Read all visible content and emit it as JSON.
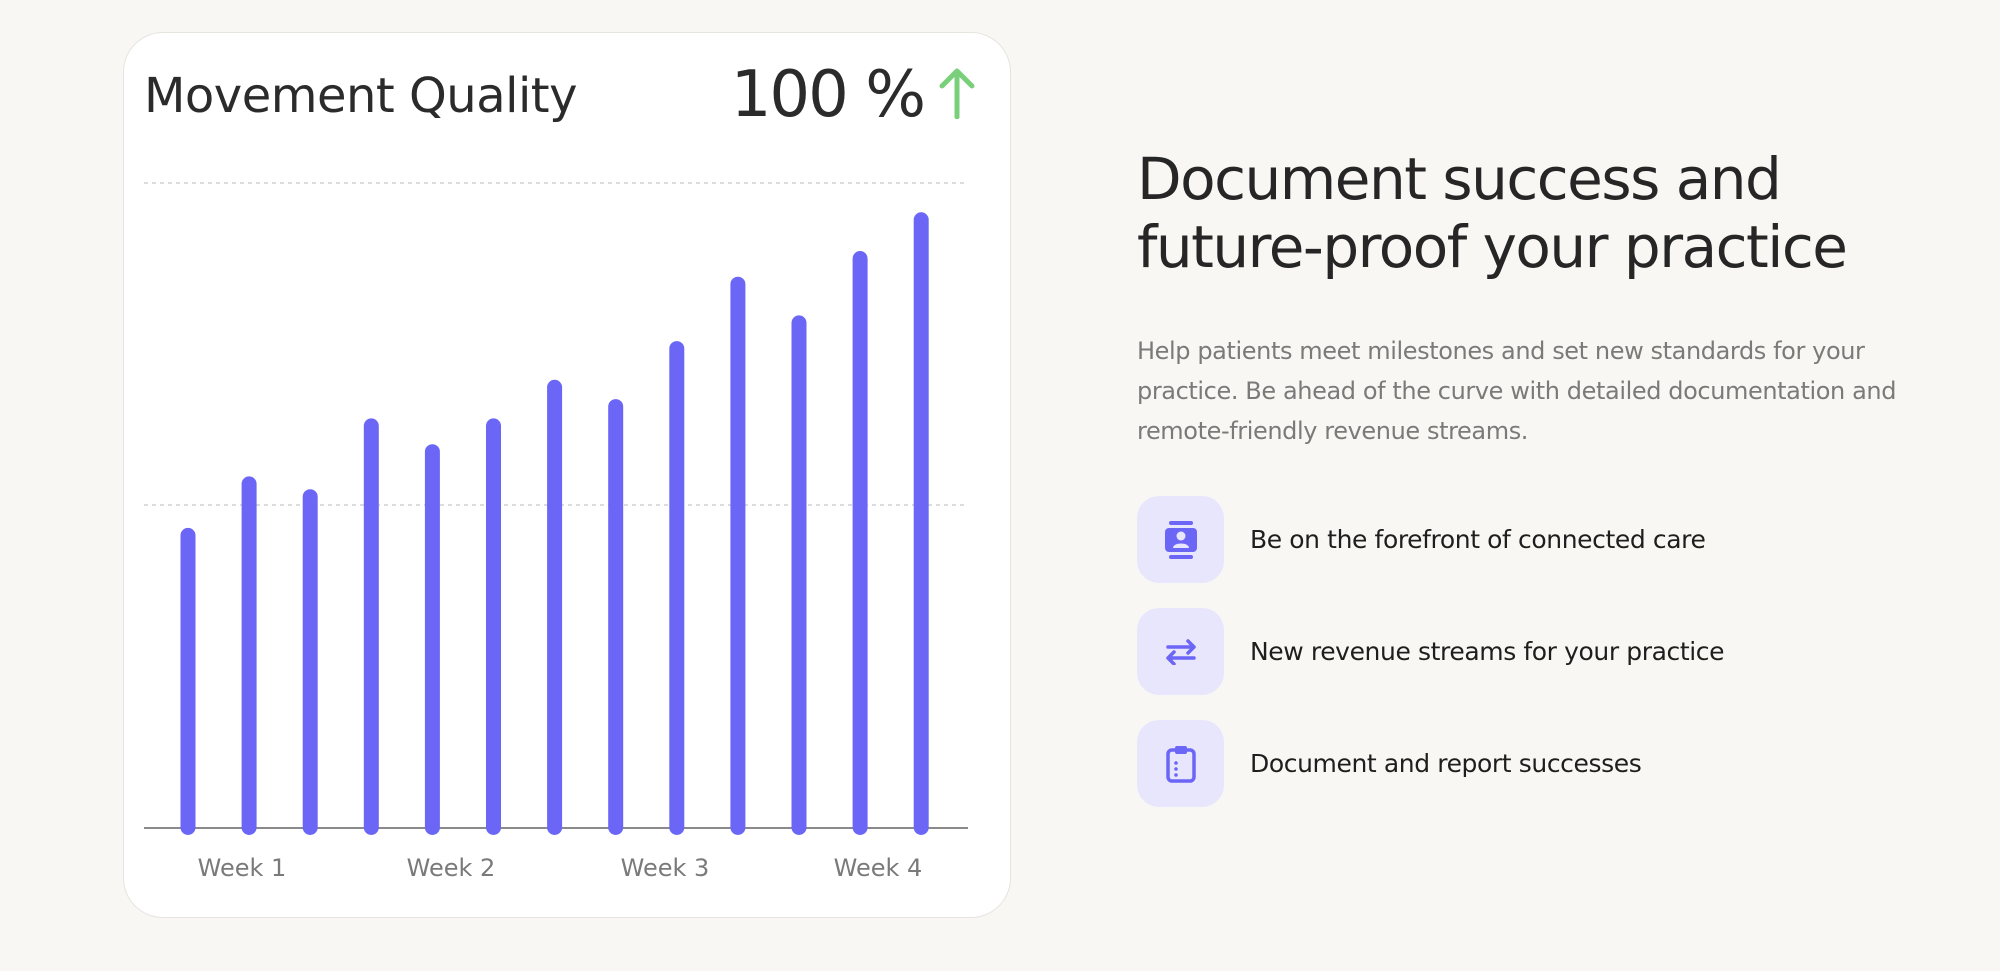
{
  "card": {
    "title": "Movement Quality",
    "stat_value": "100 %",
    "stat_icon": "arrow-up-icon",
    "stat_color": "#7ad07a"
  },
  "chart_data": {
    "type": "bar",
    "categories": [
      "Week 1",
      "Week 2",
      "Week 3",
      "Week 4"
    ],
    "values": [
      48,
      56,
      54,
      65,
      61,
      65,
      71,
      68,
      77,
      87,
      81,
      91,
      97
    ],
    "ylim": [
      0,
      100
    ],
    "grid": true,
    "bar_color": "#6b66f5"
  },
  "heading": {
    "line1": "Document success and",
    "line2": "future-proof your practice"
  },
  "description": "Help patients meet milestones and set new standards for your practice. Be ahead of the curve with detailed documentation and remote-friendly revenue streams.",
  "features": [
    {
      "icon": "contact-card-icon",
      "label": "Be on the forefront of connected care"
    },
    {
      "icon": "transfer-arrows-icon",
      "label": "New revenue streams for your practice"
    },
    {
      "icon": "clipboard-icon",
      "label": "Document and report successes"
    }
  ],
  "colors": {
    "accent": "#6b66f5",
    "icon_bg": "#e8e6fd",
    "page_bg": "#f8f7f3"
  }
}
